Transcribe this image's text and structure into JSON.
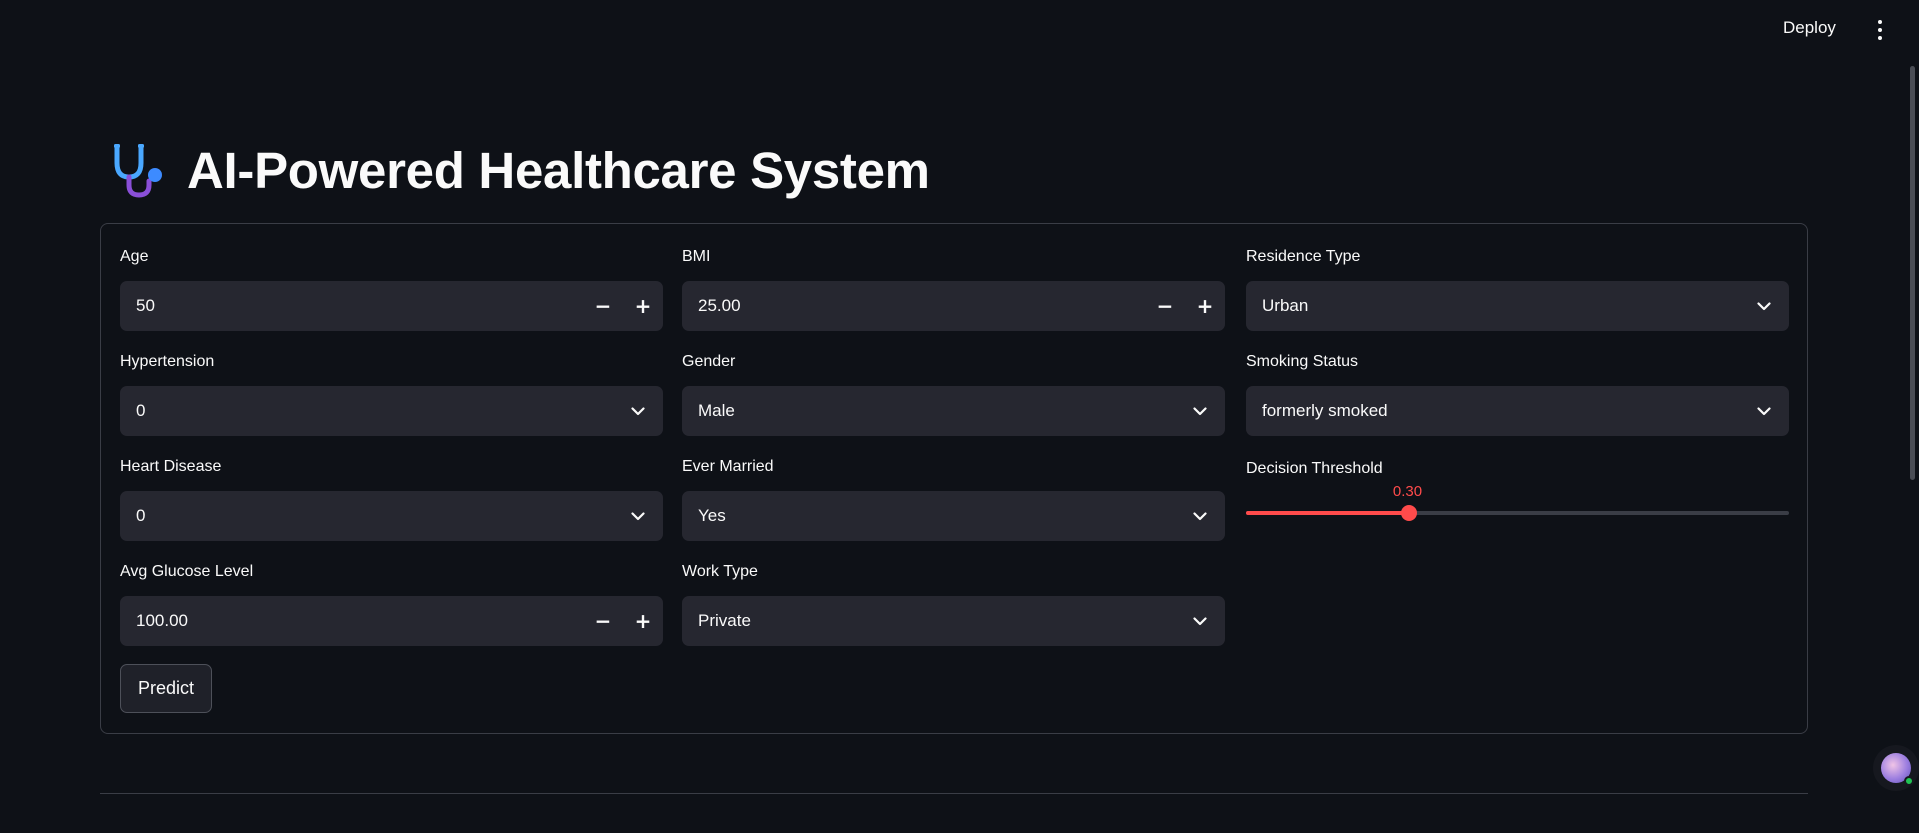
{
  "header": {
    "deploy_label": "Deploy"
  },
  "page": {
    "title": "AI-Powered Healthcare System"
  },
  "form": {
    "age": {
      "label": "Age",
      "value": "50"
    },
    "bmi": {
      "label": "BMI",
      "value": "25.00"
    },
    "residence_type": {
      "label": "Residence Type",
      "value": "Urban"
    },
    "hypertension": {
      "label": "Hypertension",
      "value": "0"
    },
    "gender": {
      "label": "Gender",
      "value": "Male"
    },
    "smoking_status": {
      "label": "Smoking Status",
      "value": "formerly smoked"
    },
    "heart_disease": {
      "label": "Heart Disease",
      "value": "0"
    },
    "ever_married": {
      "label": "Ever Married",
      "value": "Yes"
    },
    "decision_threshold": {
      "label": "Decision Threshold",
      "value": "0.30",
      "fraction": 0.3
    },
    "avg_glucose_level": {
      "label": "Avg Glucose Level",
      "value": "100.00"
    },
    "work_type": {
      "label": "Work Type",
      "value": "Private"
    },
    "predict_label": "Predict"
  },
  "icons": {
    "title_icon": "stethoscope-icon",
    "menu_icon": "kebab-menu-icon",
    "select_icon": "chevron-down-icon",
    "minus_icon": "minus-icon",
    "plus_icon": "plus-icon"
  },
  "colors": {
    "background": "#0e1117",
    "input_bg": "#262730",
    "accent": "#ff4b4b",
    "border": "#3a3d46"
  },
  "glyphs": {
    "minus": "−",
    "plus": "+"
  }
}
